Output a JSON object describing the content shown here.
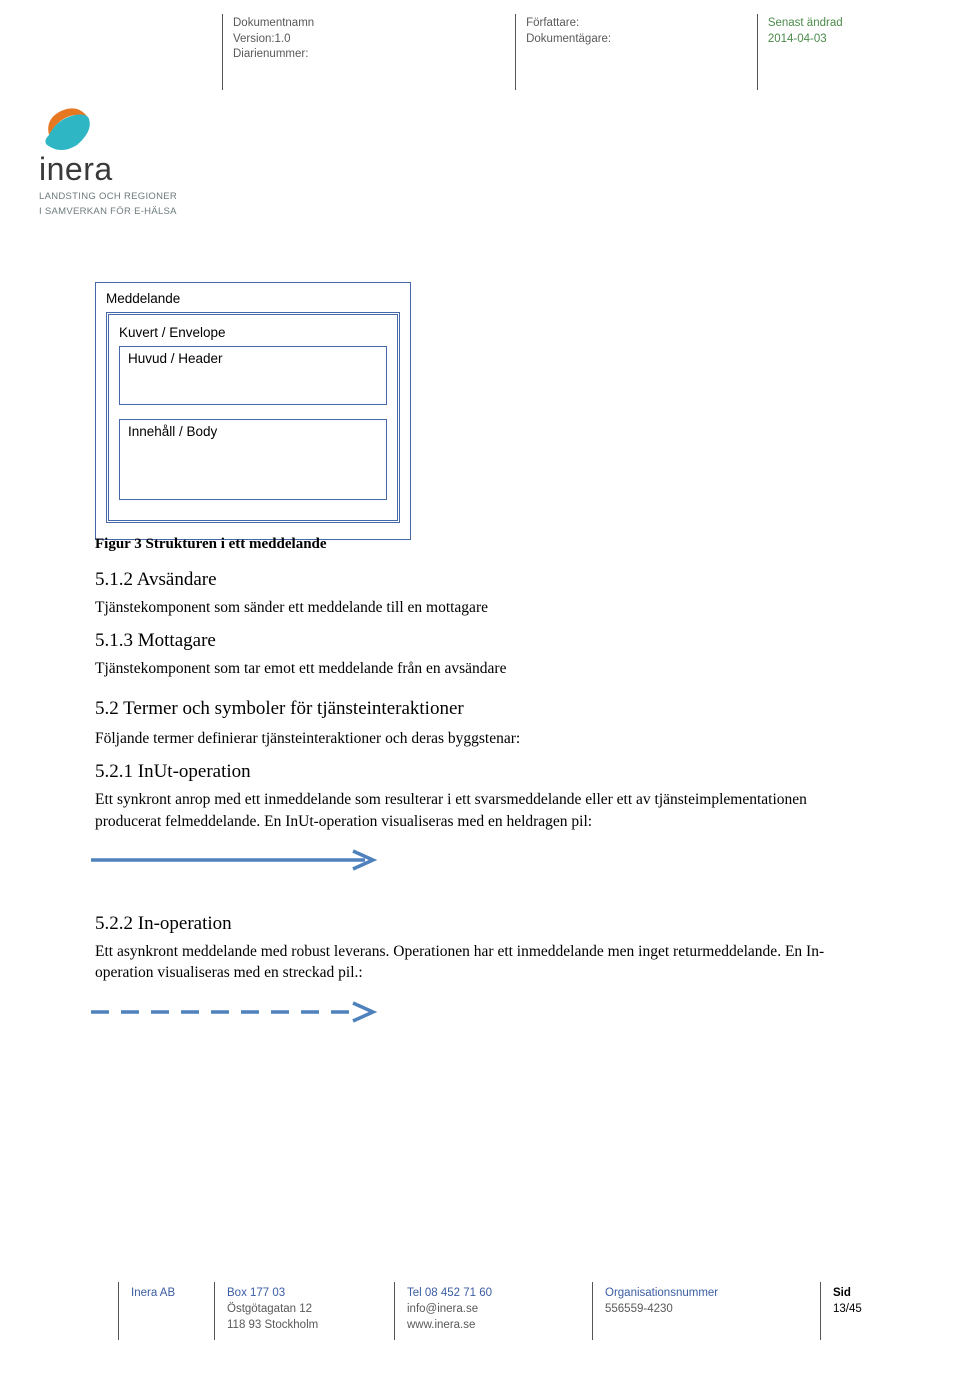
{
  "meta": {
    "col1": {
      "l1": "Dokumentnamn",
      "l2": "Version:1.0",
      "l3": "Diarienummer:"
    },
    "col2": {
      "l1": "Författare:",
      "l2": "Dokumentägare:"
    },
    "col3": {
      "l1": "Senast ändrad",
      "l2": "2014-04-03"
    }
  },
  "logo": {
    "word": "inera",
    "tag1": "LANDSTING OCH REGIONER",
    "tag2": "I SAMVERKAN FÖR E-HÄLSA"
  },
  "diagram": {
    "outer": "Meddelande",
    "middle": "Kuvert / Envelope",
    "inner1": "Huvud / Header",
    "inner2": "Innehåll / Body"
  },
  "body": {
    "figcap": "Figur 3 Strukturen i ett meddelande",
    "s512_h": "5.1.2   Avsändare",
    "s512_p": "Tjänstekomponent som sänder ett meddelande till en mottagare",
    "s513_h": "5.1.3   Mottagare",
    "s513_p": "Tjänstekomponent som tar emot ett meddelande från en avsändare",
    "s52_h": "5.2 Termer och symboler för tjänsteinteraktioner",
    "s52_p": "Följande termer definierar tjänsteinteraktioner och deras byggstenar:",
    "s521_h": "5.2.1   InUt-operation",
    "s521_p": "Ett synkront anrop med ett inmeddelande som resulterar i ett svarsmeddelande eller ett av tjänsteimplementationen producerat felmeddelande. En InUt-operation visualiseras med en heldragen pil:",
    "s522_h": "5.2.2   In-operation",
    "s522_p": "Ett asynkront meddelande med robust leverans. Operationen har ett inmeddelande men inget returmeddelande. En In-operation visualiseras med en streckad pil.:"
  },
  "footer": {
    "c1": {
      "l1": "Inera AB"
    },
    "c2": {
      "l1": "Box 177 03",
      "l2": "Östgötagatan 12",
      "l3": "118 93 Stockholm"
    },
    "c3": {
      "l1": "Tel 08 452 71 60",
      "l2": "info@inera.se",
      "l3": "www.inera.se"
    },
    "c4": {
      "l1": "Organisationsnummer",
      "l2": "556559-4230"
    },
    "c5": {
      "lbl": "Sid",
      "num": "13/45"
    }
  }
}
